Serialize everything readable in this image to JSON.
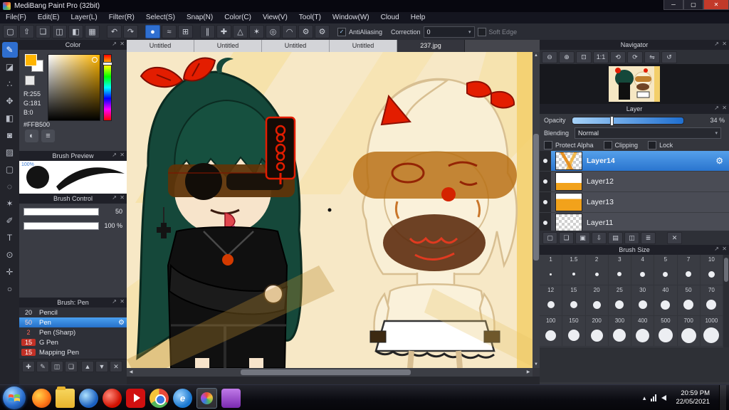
{
  "icons": {
    "gear": "⚙",
    "popout": "↗",
    "close": "✕",
    "caret_down": "▾",
    "check": "✓",
    "left": "◀",
    "right": "▶",
    "up": "▲",
    "down": "▼",
    "expand": "▴"
  },
  "window": {
    "title": "MediBang Paint Pro (32bit)",
    "minimize_glyph": "─",
    "maximize_glyph": "▢",
    "close_glyph": "✕"
  },
  "menu": {
    "items": [
      {
        "name": "menu-file",
        "label": "File(F)"
      },
      {
        "name": "menu-edit",
        "label": "Edit(E)"
      },
      {
        "name": "menu-layer",
        "label": "Layer(L)"
      },
      {
        "name": "menu-filter",
        "label": "Filter(R)"
      },
      {
        "name": "menu-select",
        "label": "Select(S)"
      },
      {
        "name": "menu-snap",
        "label": "Snap(N)"
      },
      {
        "name": "menu-color",
        "label": "Color(C)"
      },
      {
        "name": "menu-view",
        "label": "View(V)"
      },
      {
        "name": "menu-tool",
        "label": "Tool(T)"
      },
      {
        "name": "menu-window",
        "label": "Window(W)"
      },
      {
        "name": "menu-cloud",
        "label": "Cloud"
      },
      {
        "name": "menu-help",
        "label": "Help"
      }
    ]
  },
  "toolbar": {
    "icons": [
      {
        "name": "new-canvas-icon",
        "glyph": "▢"
      },
      {
        "name": "export-icon",
        "glyph": "⇧"
      },
      {
        "name": "comment-icon",
        "glyph": "❏"
      },
      {
        "name": "layout-single-icon",
        "glyph": "◫"
      },
      {
        "name": "layout-split-icon",
        "glyph": "◧"
      },
      {
        "name": "layout-grid-icon",
        "glyph": "▦"
      },
      {
        "name": "toolbar-separator",
        "sep": true
      },
      {
        "name": "undo-icon",
        "glyph": "↶"
      },
      {
        "name": "redo-icon",
        "glyph": "↷"
      },
      {
        "name": "toolbar-separator",
        "sep": true
      },
      {
        "name": "brush-shape-icon",
        "glyph": "●",
        "active": true
      },
      {
        "name": "stabilizer-icon",
        "glyph": "≈"
      },
      {
        "name": "grid-icon",
        "glyph": "⊞"
      },
      {
        "name": "toolbar-separator",
        "sep": true
      },
      {
        "name": "snap-parallel-icon",
        "glyph": "∥"
      },
      {
        "name": "snap-cross-icon",
        "glyph": "✚"
      },
      {
        "name": "snap-vanish-icon",
        "glyph": "△"
      },
      {
        "name": "snap-radial-icon",
        "glyph": "✶"
      },
      {
        "name": "snap-circle-icon",
        "glyph": "◎"
      },
      {
        "name": "snap-curve-icon",
        "glyph": "◠"
      },
      {
        "name": "snap-settings-icon",
        "glyph": "⚙"
      },
      {
        "name": "settings-icon",
        "glyph": "⚙"
      }
    ],
    "antialiasing_label": "AntiAliasing",
    "antialiasing_checked": true,
    "correction_label": "Correction",
    "correction_value": "0",
    "soft_edge_label": "Soft Edge"
  },
  "tools": [
    {
      "name": "brush-tool",
      "glyph": "✎",
      "active": true
    },
    {
      "name": "eraser-tool",
      "glyph": "◪"
    },
    {
      "name": "dot-tool",
      "glyph": "∴"
    },
    {
      "name": "move-tool",
      "glyph": "✥"
    },
    {
      "name": "fill-tool",
      "glyph": "◧"
    },
    {
      "name": "bucket-tool",
      "glyph": "◙"
    },
    {
      "name": "gradient-tool",
      "glyph": "▨"
    },
    {
      "name": "select-tool",
      "glyph": "▢"
    },
    {
      "name": "lasso-tool",
      "glyph": "◌"
    },
    {
      "name": "magic-wand-tool",
      "glyph": "✶"
    },
    {
      "name": "select-pen-tool",
      "glyph": "✐"
    },
    {
      "name": "text-tool",
      "glyph": "T"
    },
    {
      "name": "eyedropper-tool",
      "glyph": "⊙"
    },
    {
      "name": "hand-tool",
      "glyph": "✛"
    },
    {
      "name": "zoom-tool",
      "glyph": "○"
    }
  ],
  "tabs": [
    {
      "label": "Untitled"
    },
    {
      "label": "Untitled"
    },
    {
      "label": "Untitled"
    },
    {
      "label": "Untitled"
    },
    {
      "label": "237.jpg",
      "active": true
    }
  ],
  "color_panel": {
    "title": "Color",
    "r": "R:255",
    "g": "G:181",
    "b": "B:0",
    "hex": "#FFB500",
    "buttons": [
      {
        "name": "screen-picker-icon",
        "glyph": "◐"
      },
      {
        "name": "palette-mode-icon",
        "glyph": "≡"
      }
    ]
  },
  "brush_preview": {
    "title": "Brush Preview",
    "zoom_label": "100%"
  },
  "brush_control": {
    "title": "Brush Control",
    "sliders": [
      {
        "name": "brush-size-slider",
        "value": "50"
      },
      {
        "name": "brush-opacity-slider",
        "value": "100 %"
      }
    ]
  },
  "brush_list": {
    "title": "Brush: Pen",
    "items": [
      {
        "size": "20",
        "name": "Pencil",
        "style": "plain"
      },
      {
        "size": "50",
        "name": "Pen",
        "selected": true,
        "style": "red-text"
      },
      {
        "size": "2",
        "name": "Pen (Sharp)",
        "style": "red-text"
      },
      {
        "size": "15",
        "name": "G Pen",
        "style": "red-chip"
      },
      {
        "size": "15",
        "name": "Mapping Pen",
        "style": "red-chip"
      }
    ],
    "footer_icons": [
      {
        "name": "add-brush-icon",
        "glyph": "✚"
      },
      {
        "name": "edit-brush-icon",
        "glyph": "✎"
      },
      {
        "name": "duplicate-brush-icon",
        "glyph": "◫"
      },
      {
        "name": "brush-folder-icon",
        "glyph": "❏"
      }
    ],
    "footer_right_icons": [
      {
        "name": "brush-up-icon",
        "glyph": "▲"
      },
      {
        "name": "brush-down-icon",
        "glyph": "▼"
      },
      {
        "name": "delete-brush-icon",
        "glyph": "✕"
      }
    ]
  },
  "navigator": {
    "title": "Navigator",
    "buttons": [
      {
        "name": "zoom-out-icon",
        "glyph": "⊖"
      },
      {
        "name": "zoom-in-icon",
        "glyph": "⊕"
      },
      {
        "name": "zoom-fit-icon",
        "glyph": "⊡"
      },
      {
        "name": "zoom-actual-icon",
        "glyph": "1:1"
      },
      {
        "name": "rotate-left-icon",
        "glyph": "⟲"
      },
      {
        "name": "rotate-right-icon",
        "glyph": "⟳"
      },
      {
        "name": "flip-horizontal-icon",
        "glyph": "⇋"
      },
      {
        "name": "reset-view-icon",
        "glyph": "↺"
      }
    ]
  },
  "layer_panel": {
    "title": "Layer",
    "opacity_label": "Opacity",
    "opacity_value": "34 %",
    "blending_label": "Blending",
    "blending_value": "Normal",
    "checkboxes": [
      {
        "name": "protect-alpha-checkbox",
        "label": "Protect Alpha"
      },
      {
        "name": "clipping-checkbox",
        "label": "Clipping"
      },
      {
        "name": "lock-checkbox",
        "label": "Lock"
      }
    ],
    "layers": [
      {
        "name": "Layer14",
        "selected": true,
        "thumb": "checker-art"
      },
      {
        "name": "Layer12",
        "thumb": "orange-low"
      },
      {
        "name": "Layer13",
        "thumb": "orange-mid"
      },
      {
        "name": "Layer11",
        "thumb": "checker-plain"
      }
    ],
    "buttons": [
      {
        "name": "new-layer-icon",
        "glyph": "▢"
      },
      {
        "name": "new-folder-icon",
        "glyph": "❏"
      },
      {
        "name": "layer-settings-icon",
        "glyph": "▣"
      },
      {
        "name": "import-image-icon",
        "glyph": "⇩"
      },
      {
        "name": "folder-icon",
        "glyph": "▤"
      },
      {
        "name": "duplicate-layer-icon",
        "glyph": "◫"
      },
      {
        "name": "merge-down-icon",
        "glyph": "≣"
      },
      {
        "name": "delete-layer-icon",
        "glyph": "✕",
        "trash": true
      }
    ]
  },
  "brush_size": {
    "title": "Brush Size",
    "sizes": [
      "1",
      "1.5",
      "2",
      "3",
      "4",
      "5",
      "7",
      "10",
      "12",
      "15",
      "20",
      "25",
      "30",
      "40",
      "50",
      "70",
      "100",
      "150",
      "200",
      "300",
      "400",
      "500",
      "700",
      "1000"
    ]
  },
  "taskbar": {
    "time": "20:59 PM",
    "date": "22/05/2021",
    "apps": [
      {
        "name": "taskbar-firefox-icon",
        "style": "firefox"
      },
      {
        "name": "taskbar-folder-icon",
        "style": "folder"
      },
      {
        "name": "taskbar-media-icon",
        "style": "media"
      },
      {
        "name": "taskbar-opera-icon",
        "style": "opera"
      },
      {
        "name": "taskbar-youtube-icon",
        "style": "youtube"
      },
      {
        "name": "taskbar-chrome-icon",
        "style": "chrome"
      },
      {
        "name": "taskbar-ie-icon",
        "style": "ie",
        "glyph": "e"
      },
      {
        "name": "taskbar-medibang-icon",
        "style": "medibang",
        "active": true
      },
      {
        "name": "taskbar-gacha-icon",
        "style": "gacha"
      }
    ]
  }
}
